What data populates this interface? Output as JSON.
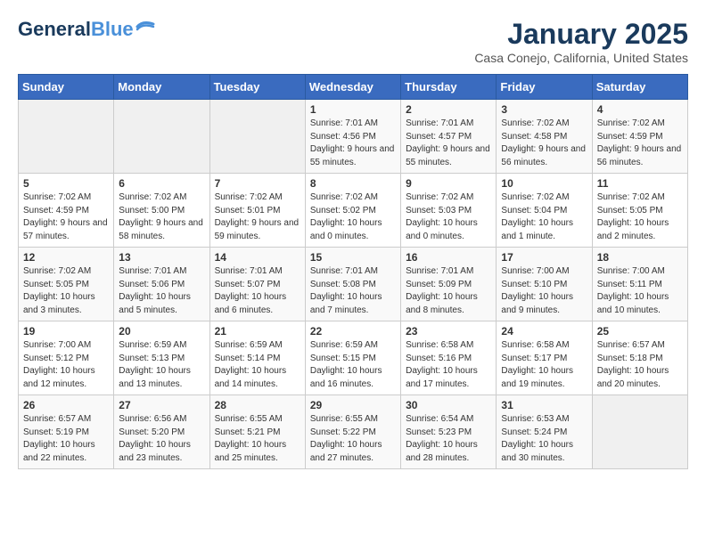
{
  "header": {
    "logo_main": "General",
    "logo_accent": "Blue",
    "month_title": "January 2025",
    "location": "Casa Conejo, California, United States"
  },
  "weekdays": [
    "Sunday",
    "Monday",
    "Tuesday",
    "Wednesday",
    "Thursday",
    "Friday",
    "Saturday"
  ],
  "weeks": [
    [
      {
        "day": "",
        "info": ""
      },
      {
        "day": "",
        "info": ""
      },
      {
        "day": "",
        "info": ""
      },
      {
        "day": "1",
        "info": "Sunrise: 7:01 AM\nSunset: 4:56 PM\nDaylight: 9 hours\nand 55 minutes."
      },
      {
        "day": "2",
        "info": "Sunrise: 7:01 AM\nSunset: 4:57 PM\nDaylight: 9 hours\nand 55 minutes."
      },
      {
        "day": "3",
        "info": "Sunrise: 7:02 AM\nSunset: 4:58 PM\nDaylight: 9 hours\nand 56 minutes."
      },
      {
        "day": "4",
        "info": "Sunrise: 7:02 AM\nSunset: 4:59 PM\nDaylight: 9 hours\nand 56 minutes."
      }
    ],
    [
      {
        "day": "5",
        "info": "Sunrise: 7:02 AM\nSunset: 4:59 PM\nDaylight: 9 hours\nand 57 minutes."
      },
      {
        "day": "6",
        "info": "Sunrise: 7:02 AM\nSunset: 5:00 PM\nDaylight: 9 hours\nand 58 minutes."
      },
      {
        "day": "7",
        "info": "Sunrise: 7:02 AM\nSunset: 5:01 PM\nDaylight: 9 hours\nand 59 minutes."
      },
      {
        "day": "8",
        "info": "Sunrise: 7:02 AM\nSunset: 5:02 PM\nDaylight: 10 hours\nand 0 minutes."
      },
      {
        "day": "9",
        "info": "Sunrise: 7:02 AM\nSunset: 5:03 PM\nDaylight: 10 hours\nand 0 minutes."
      },
      {
        "day": "10",
        "info": "Sunrise: 7:02 AM\nSunset: 5:04 PM\nDaylight: 10 hours\nand 1 minute."
      },
      {
        "day": "11",
        "info": "Sunrise: 7:02 AM\nSunset: 5:05 PM\nDaylight: 10 hours\nand 2 minutes."
      }
    ],
    [
      {
        "day": "12",
        "info": "Sunrise: 7:02 AM\nSunset: 5:05 PM\nDaylight: 10 hours\nand 3 minutes."
      },
      {
        "day": "13",
        "info": "Sunrise: 7:01 AM\nSunset: 5:06 PM\nDaylight: 10 hours\nand 5 minutes."
      },
      {
        "day": "14",
        "info": "Sunrise: 7:01 AM\nSunset: 5:07 PM\nDaylight: 10 hours\nand 6 minutes."
      },
      {
        "day": "15",
        "info": "Sunrise: 7:01 AM\nSunset: 5:08 PM\nDaylight: 10 hours\nand 7 minutes."
      },
      {
        "day": "16",
        "info": "Sunrise: 7:01 AM\nSunset: 5:09 PM\nDaylight: 10 hours\nand 8 minutes."
      },
      {
        "day": "17",
        "info": "Sunrise: 7:00 AM\nSunset: 5:10 PM\nDaylight: 10 hours\nand 9 minutes."
      },
      {
        "day": "18",
        "info": "Sunrise: 7:00 AM\nSunset: 5:11 PM\nDaylight: 10 hours\nand 10 minutes."
      }
    ],
    [
      {
        "day": "19",
        "info": "Sunrise: 7:00 AM\nSunset: 5:12 PM\nDaylight: 10 hours\nand 12 minutes."
      },
      {
        "day": "20",
        "info": "Sunrise: 6:59 AM\nSunset: 5:13 PM\nDaylight: 10 hours\nand 13 minutes."
      },
      {
        "day": "21",
        "info": "Sunrise: 6:59 AM\nSunset: 5:14 PM\nDaylight: 10 hours\nand 14 minutes."
      },
      {
        "day": "22",
        "info": "Sunrise: 6:59 AM\nSunset: 5:15 PM\nDaylight: 10 hours\nand 16 minutes."
      },
      {
        "day": "23",
        "info": "Sunrise: 6:58 AM\nSunset: 5:16 PM\nDaylight: 10 hours\nand 17 minutes."
      },
      {
        "day": "24",
        "info": "Sunrise: 6:58 AM\nSunset: 5:17 PM\nDaylight: 10 hours\nand 19 minutes."
      },
      {
        "day": "25",
        "info": "Sunrise: 6:57 AM\nSunset: 5:18 PM\nDaylight: 10 hours\nand 20 minutes."
      }
    ],
    [
      {
        "day": "26",
        "info": "Sunrise: 6:57 AM\nSunset: 5:19 PM\nDaylight: 10 hours\nand 22 minutes."
      },
      {
        "day": "27",
        "info": "Sunrise: 6:56 AM\nSunset: 5:20 PM\nDaylight: 10 hours\nand 23 minutes."
      },
      {
        "day": "28",
        "info": "Sunrise: 6:55 AM\nSunset: 5:21 PM\nDaylight: 10 hours\nand 25 minutes."
      },
      {
        "day": "29",
        "info": "Sunrise: 6:55 AM\nSunset: 5:22 PM\nDaylight: 10 hours\nand 27 minutes."
      },
      {
        "day": "30",
        "info": "Sunrise: 6:54 AM\nSunset: 5:23 PM\nDaylight: 10 hours\nand 28 minutes."
      },
      {
        "day": "31",
        "info": "Sunrise: 6:53 AM\nSunset: 5:24 PM\nDaylight: 10 hours\nand 30 minutes."
      },
      {
        "day": "",
        "info": ""
      }
    ]
  ]
}
